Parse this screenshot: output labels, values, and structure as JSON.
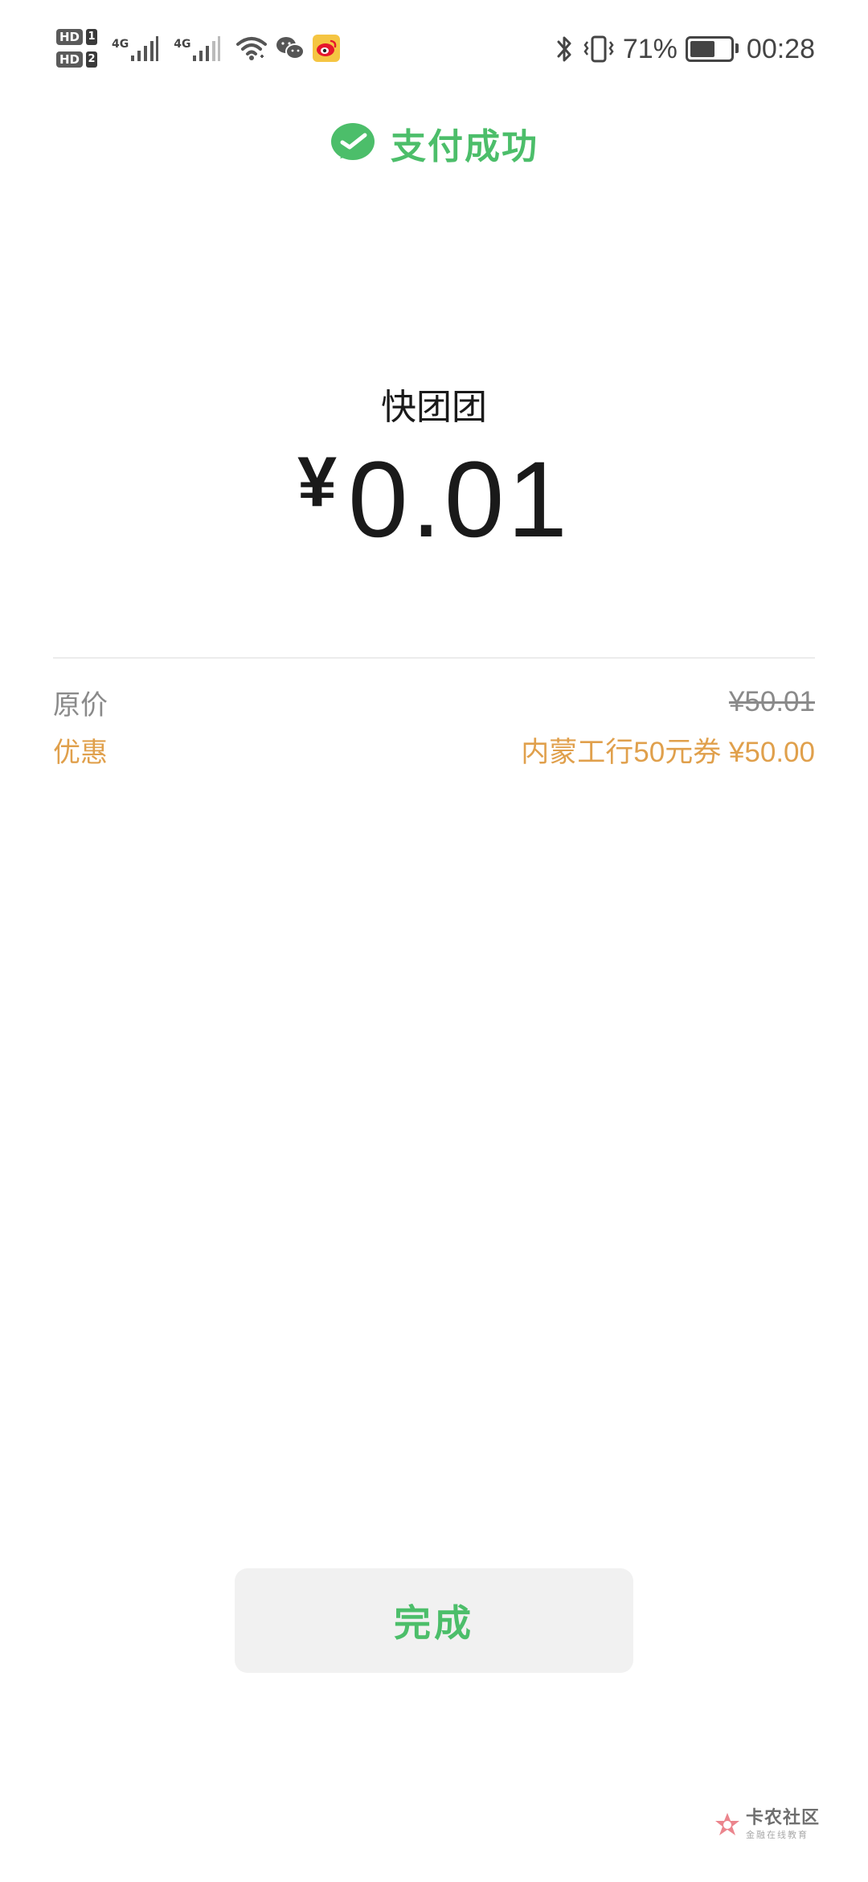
{
  "status_bar": {
    "hd1": "HD",
    "sim1": "1",
    "hd2": "HD",
    "sim2": "2",
    "network1": "4G",
    "network2": "4G",
    "battery_percent": "71%",
    "battery_level": 0.71,
    "time": "00:28",
    "icons": [
      "signal-icon",
      "wifi-icon",
      "wechat-icon",
      "weibo-icon",
      "bluetooth-icon",
      "vibrate-icon",
      "battery-icon"
    ]
  },
  "header": {
    "title": "支付成功",
    "icon": "wechat-pay-icon"
  },
  "payment": {
    "merchant": "快团团",
    "currency": "¥",
    "amount": "0.01"
  },
  "details": {
    "original_label": "原价",
    "original_value": "¥50.01",
    "discount_label": "优惠",
    "discount_value": "内蒙工行50元券 ¥50.00"
  },
  "actions": {
    "done_label": "完成"
  },
  "watermark": {
    "title": "卡农社区",
    "subtitle": "金融在线教育"
  },
  "colors": {
    "brand_green": "#4cbe6a",
    "discount_orange": "#e0a04c",
    "muted_gray": "#8a8a8a",
    "button_bg": "#f1f1f1"
  }
}
